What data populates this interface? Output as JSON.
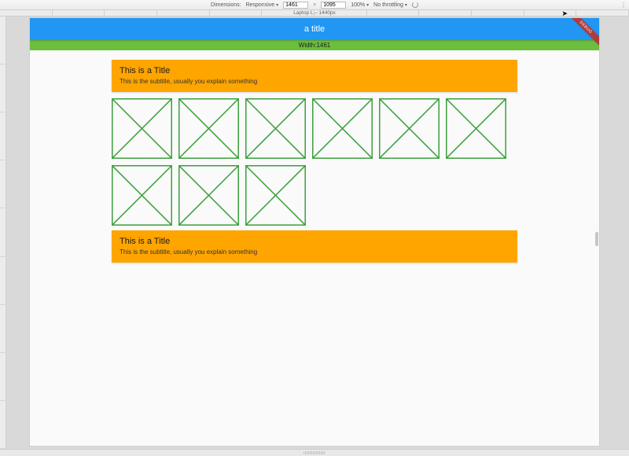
{
  "device_toolbar": {
    "dimensions_label": "Dimensions:",
    "preset": "Responsive",
    "width": "1461",
    "height": "1095",
    "zoom": "100%",
    "throttling": "No throttling",
    "device_label": "Laptop L – 1440px"
  },
  "app": {
    "appbar_title": "a title",
    "debug_banner": "DEBUG",
    "width_banner_prefix": "Width: ",
    "width_banner_value": "1461"
  },
  "cards": [
    {
      "title": "This is a Title",
      "subtitle": "This is the subtitle, usually you explain something"
    },
    {
      "title": "This is a Title",
      "subtitle": "This is the subtitle, usually you explain something"
    }
  ],
  "placeholders": {
    "count": 9
  }
}
